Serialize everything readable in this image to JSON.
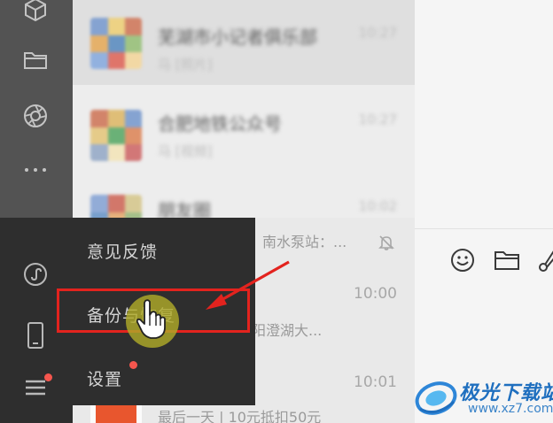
{
  "sidebar": {
    "icons": [
      "cube-icon",
      "folder-icon",
      "aperture-icon",
      "more-icon",
      "mini-program-icon",
      "phone-icon",
      "menu-icon"
    ],
    "accent": "#2e2e2e"
  },
  "chats": [
    {
      "title": "芜湖市小记者俱乐部",
      "preview": "马 [照片]",
      "time": "10:27"
    },
    {
      "title": "合肥地铁公众号",
      "preview": "马 [视频]",
      "time": "10:27"
    },
    {
      "title": "朋友圈",
      "preview": "南水泵站：...",
      "time": "10:02"
    },
    {
      "title": "",
      "preview": "阳澄湖大...",
      "time": "10:00"
    },
    {
      "title": "",
      "preview": "最后一天 | 10元抵扣50元",
      "time": "10:01"
    }
  ],
  "menu": {
    "items": [
      {
        "label": "意见反馈"
      },
      {
        "label": "备份与恢复"
      },
      {
        "label": "设置"
      }
    ]
  },
  "toolbar": {
    "icons": [
      "emoji-icon",
      "folder-icon",
      "scissors-icon"
    ]
  },
  "watermark": {
    "title": "极光下载站",
    "url": "www.xz7.com"
  },
  "colors": {
    "highlight": "#e3231e",
    "badge": "#f5564e",
    "menu_bg": "#2e2e2e"
  }
}
